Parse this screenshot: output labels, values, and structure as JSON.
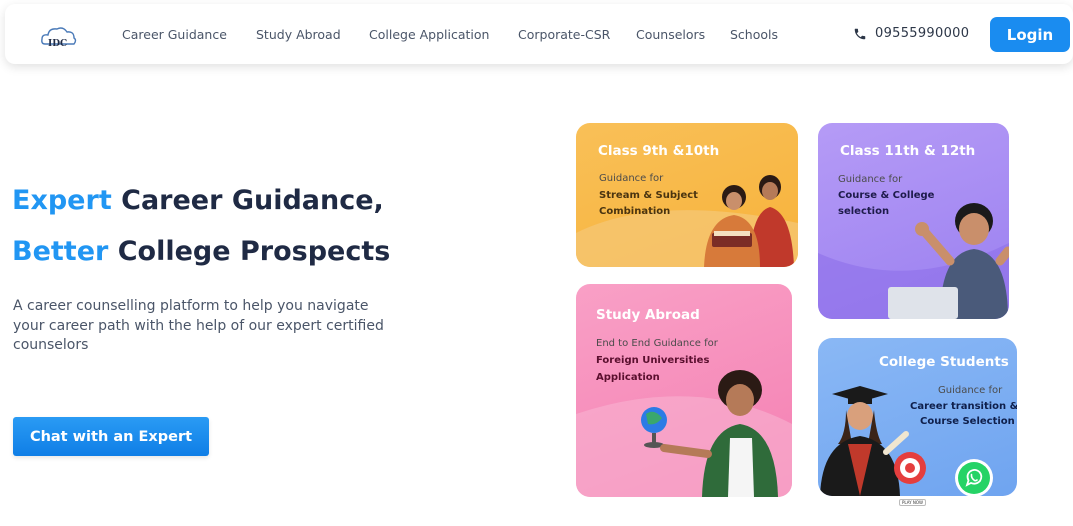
{
  "header": {
    "logo_text": "IDC",
    "nav": [
      "Career Guidance",
      "Study Abroad",
      "College Application",
      "Corporate-CSR",
      "Counselors",
      "Schools"
    ],
    "phone": "09555990000",
    "login_label": "Login"
  },
  "hero": {
    "line1_accent": "Expert",
    "line1_rest": " Career Guidance,",
    "line2_accent": "Better",
    "line2_rest": " College Prospects",
    "subtext": "A career counselling platform to help you navigate your career path with the help of our expert certified counselors",
    "cta_label": "Chat with an Expert"
  },
  "cards": {
    "class9": {
      "title": "Class 9th &10th",
      "sub": "Guidance for",
      "strong1": "Stream & Subject",
      "strong2": "Combination"
    },
    "class11": {
      "title": "Class 11th & 12th",
      "sub": "Guidance for",
      "strong1": "Course & College",
      "strong2": "selection"
    },
    "abroad": {
      "title": "Study Abroad",
      "sub": "End to End Guidance for",
      "strong1": "Foreign Universities",
      "strong2": "Application"
    },
    "college": {
      "title": "College Students",
      "sub": "Guidance for",
      "strong1": "Career transition &",
      "strong2": "Course Selection"
    }
  },
  "widgets": {
    "play_now": "PLAY NOW"
  },
  "colors": {
    "brand": "#1a8cf0",
    "accent_text": "#2196f3",
    "heading": "#1f2a44"
  }
}
